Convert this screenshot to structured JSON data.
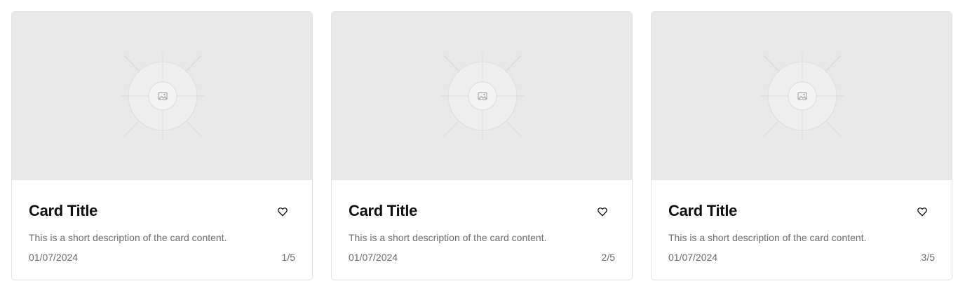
{
  "cards": [
    {
      "title": "Card Title",
      "description": "This is a short description of the card content.",
      "date": "01/07/2024",
      "position": "1/5",
      "favorite_icon": "heart-outline-icon",
      "media_icon": "image-placeholder-icon"
    },
    {
      "title": "Card Title",
      "description": "This is a short description of the card content.",
      "date": "01/07/2024",
      "position": "2/5",
      "favorite_icon": "heart-outline-icon",
      "media_icon": "image-placeholder-icon"
    },
    {
      "title": "Card Title",
      "description": "This is a short description of the card content.",
      "date": "01/07/2024",
      "position": "3/5",
      "favorite_icon": "heart-outline-icon",
      "media_icon": "image-placeholder-icon"
    }
  ],
  "colors": {
    "placeholder_bg": "#e8e8e8",
    "border": "#e2e2e2",
    "title": "#111111",
    "muted_text": "#6b6b6b"
  }
}
